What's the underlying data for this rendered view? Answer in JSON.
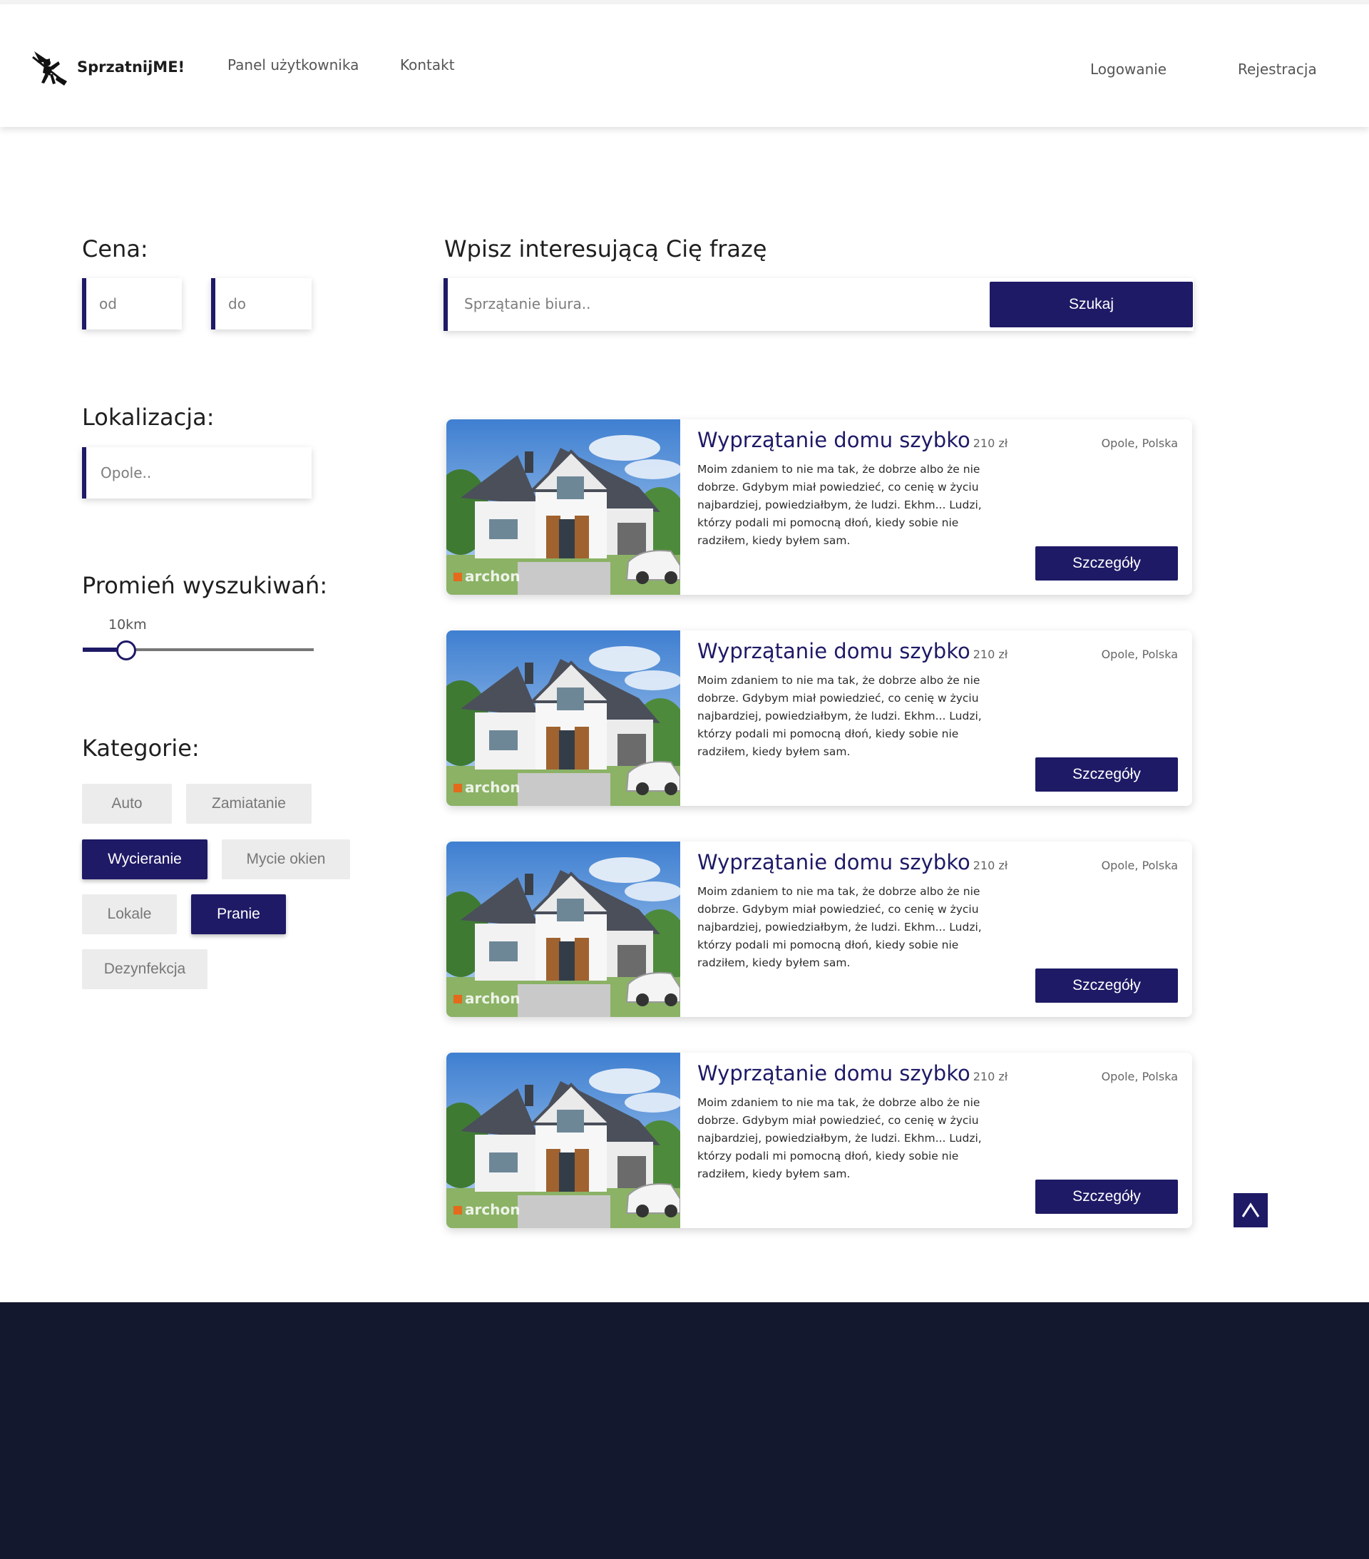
{
  "brand": {
    "name": "SprzatnijME!"
  },
  "nav": {
    "left": [
      "Panel użytkownika",
      "Kontakt"
    ],
    "right": [
      "Logowanie",
      "Rejestracja"
    ]
  },
  "filters": {
    "price": {
      "label": "Cena:",
      "from_placeholder": "od",
      "to_placeholder": "do"
    },
    "location": {
      "label": "Lokalizacja:",
      "placeholder": "Opole.."
    },
    "radius": {
      "label": "Promień wyszukiwań:",
      "value": "10km",
      "fraction": 0.15
    },
    "categories": {
      "label": "Kategorie:",
      "items": [
        {
          "label": "Auto",
          "active": false
        },
        {
          "label": "Zamiatanie",
          "active": false
        },
        {
          "label": "Wycieranie",
          "active": true
        },
        {
          "label": "Mycie okien",
          "active": false
        },
        {
          "label": "Lokale",
          "active": false
        },
        {
          "label": "Pranie",
          "active": true
        },
        {
          "label": "Dezynfekcja",
          "active": false
        }
      ]
    }
  },
  "search": {
    "label": "Wpisz interesującą Cię frazę",
    "placeholder": "Sprzątanie biura..",
    "button": "Szukaj"
  },
  "listings": [
    {
      "title": "Wyprzątanie domu szybko",
      "price": "210 zł",
      "location": "Opole, Polska",
      "description": "Moim zdaniem to nie ma tak, że dobrze albo że nie dobrze. Gdybym miał powiedzieć, co cenię w życiu najbardziej, powiedziałbym, że ludzi. Ekhm... Ludzi, którzy podali mi pomocną dłoń, kiedy sobie nie radziłem, kiedy byłem sam.",
      "button": "Szczegóły",
      "image_watermark": "archon"
    },
    {
      "title": "Wyprzątanie domu szybko",
      "price": "210 zł",
      "location": "Opole, Polska",
      "description": "Moim zdaniem to nie ma tak, że dobrze albo że nie dobrze. Gdybym miał powiedzieć, co cenię w życiu najbardziej, powiedziałbym, że ludzi. Ekhm... Ludzi, którzy podali mi pomocną dłoń, kiedy sobie nie radziłem, kiedy byłem sam.",
      "button": "Szczegóły",
      "image_watermark": "archon"
    },
    {
      "title": "Wyprzątanie domu szybko",
      "price": "210 zł",
      "location": "Opole, Polska",
      "description": "Moim zdaniem to nie ma tak, że dobrze albo że nie dobrze. Gdybym miał powiedzieć, co cenię w życiu najbardziej, powiedziałbym, że ludzi. Ekhm... Ludzi, którzy podali mi pomocną dłoń, kiedy sobie nie radziłem, kiedy byłem sam.",
      "button": "Szczegóły",
      "image_watermark": "archon"
    },
    {
      "title": "Wyprzątanie domu szybko",
      "price": "210 zł",
      "location": "Opole, Polska",
      "description": "Moim zdaniem to nie ma tak, że dobrze albo że nie dobrze. Gdybym miał powiedzieć, co cenię w życiu najbardziej, powiedziałbym, że ludzi. Ekhm... Ludzi, którzy podali mi pomocną dłoń, kiedy sobie nie radziłem, kiedy byłem sam.",
      "button": "Szczegóły",
      "image_watermark": "archon"
    }
  ],
  "icons": {
    "logo": "witch-on-broom-icon",
    "scroll_top": "chevron-up-icon",
    "house": "house-photo"
  },
  "colors": {
    "accent": "#1e1a66",
    "footer": "#14182e",
    "chip": "#ececec"
  }
}
